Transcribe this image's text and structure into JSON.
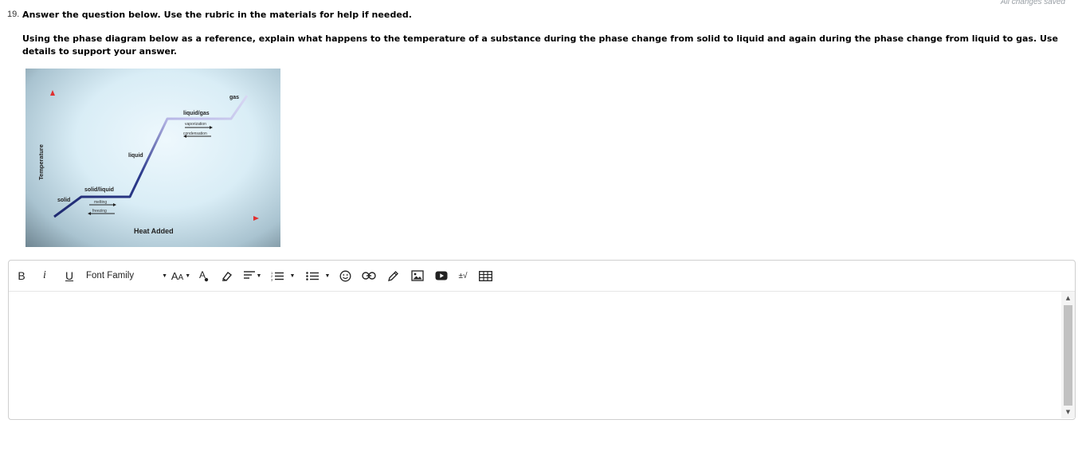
{
  "autosave_status": "All changes saved",
  "question": {
    "number": "19.",
    "title": "Answer the question below. Use the rubric in the materials for help if needed.",
    "prompt": "Using the phase diagram below as a reference, explain what happens to the temperature of a substance during the phase change from solid to liquid and again during the phase change from liquid to gas. Use details to support your answer."
  },
  "diagram": {
    "y_axis_label": "Temperature",
    "x_axis_label": "Heat Added",
    "labels": {
      "solid": "solid",
      "solid_liquid": "solid/liquid",
      "melting": "melting",
      "freezing": "freezing",
      "liquid": "liquid",
      "liquid_gas": "liquid/gas",
      "vaporization": "vaporization",
      "condensation": "condensation",
      "gas": "gas"
    },
    "colors": {
      "axis_y": "#e03030",
      "axis_x": "#e03030",
      "curve_dark": "#27307a",
      "curve_light": "#c9c9ee"
    }
  },
  "editor": {
    "toolbar": {
      "bold": "B",
      "italic": "i",
      "underline": "U",
      "font_family": "Font Family",
      "font_size_icon": "font-size-icon",
      "text_color_icon": "text-color-icon",
      "highlight_icon": "highlighter-icon",
      "align_icon": "align-icon",
      "ordered_list_icon": "ordered-list-icon",
      "unordered_list_icon": "unordered-list-icon",
      "emoji_icon": "emoji-icon",
      "link_icon": "link-icon",
      "pencil_icon": "pencil-icon",
      "image_icon": "image-icon",
      "video_icon": "video-icon",
      "equation": "±√",
      "table_icon": "table-icon"
    },
    "content": ""
  }
}
